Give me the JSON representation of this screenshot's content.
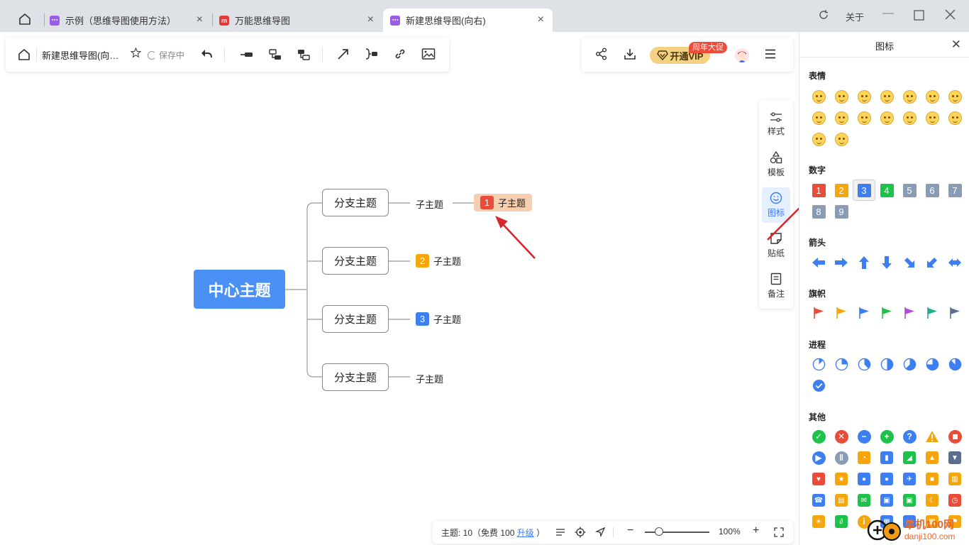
{
  "tabs": [
    {
      "label": "示例（思维导图使用方法）",
      "icon_color": "#9b5de5",
      "active": false
    },
    {
      "label": "万能思维导图",
      "icon_color": "#e53935",
      "active": false
    },
    {
      "label": "新建思维导图(向右)",
      "icon_color": "#9b5de5",
      "active": true
    }
  ],
  "window": {
    "about_label": "关于"
  },
  "toolbar": {
    "doc_title": "新建思维导图(向…",
    "save_status": "保存中",
    "vip_label": "开通VIP",
    "vip_badge": "周年大促"
  },
  "side_dock": {
    "items": [
      {
        "label": "样式",
        "icon": "style-sliders-icon"
      },
      {
        "label": "模板",
        "icon": "template-shapes-icon"
      },
      {
        "label": "图标",
        "icon": "smiley-icon",
        "active": true
      },
      {
        "label": "贴纸",
        "icon": "sticker-icon"
      },
      {
        "label": "备注",
        "icon": "note-icon"
      }
    ]
  },
  "mindmap": {
    "central": "中心主题",
    "branches": [
      {
        "label": "分支主题",
        "child": "子主题",
        "marker": "1",
        "marker_color": "#e94d3a",
        "selected": true
      },
      {
        "label": "分支主题",
        "child": "子主题",
        "marker": "2",
        "marker_color": "#f5a60d",
        "selected": false
      },
      {
        "label": "分支主题",
        "child": "子主题",
        "marker": "3",
        "marker_color": "#3d7ff0",
        "selected": false
      },
      {
        "label": "分支主题",
        "child": "子主题",
        "marker": "",
        "marker_color": "",
        "selected": false
      }
    ]
  },
  "statusbar": {
    "topics_text": "主题: 10（免费 100",
    "upgrade_label": "升级",
    "close_paren": "）",
    "zoom": "100%"
  },
  "icon_panel": {
    "title": "图标",
    "sections": {
      "emotion": "表情",
      "numbers": "数字",
      "arrows": "箭头",
      "flags": "旗帜",
      "progress": "进程",
      "others": "其他"
    },
    "number_items": [
      {
        "n": "1",
        "color": "#e94d3a"
      },
      {
        "n": "2",
        "color": "#f5a60d"
      },
      {
        "n": "3",
        "color": "#3d7ff0",
        "selected": true
      },
      {
        "n": "4",
        "color": "#1ec14a"
      },
      {
        "n": "5",
        "color": "#8a9bb5"
      },
      {
        "n": "6",
        "color": "#8a9bb5"
      },
      {
        "n": "7",
        "color": "#8a9bb5"
      },
      {
        "n": "8",
        "color": "#8a9bb5"
      },
      {
        "n": "9",
        "color": "#8a9bb5"
      }
    ],
    "flag_colors": [
      "#e94d3a",
      "#f5a60d",
      "#3d7ff0",
      "#1ec14a",
      "#b04be0",
      "#1fae8f",
      "#5b6e8f"
    ],
    "progress_levels": [
      0.125,
      0.25,
      0.375,
      0.5,
      0.625,
      0.75,
      0.875,
      1.0
    ]
  },
  "watermark": {
    "text": "单机100网",
    "url": "danji100.com"
  }
}
